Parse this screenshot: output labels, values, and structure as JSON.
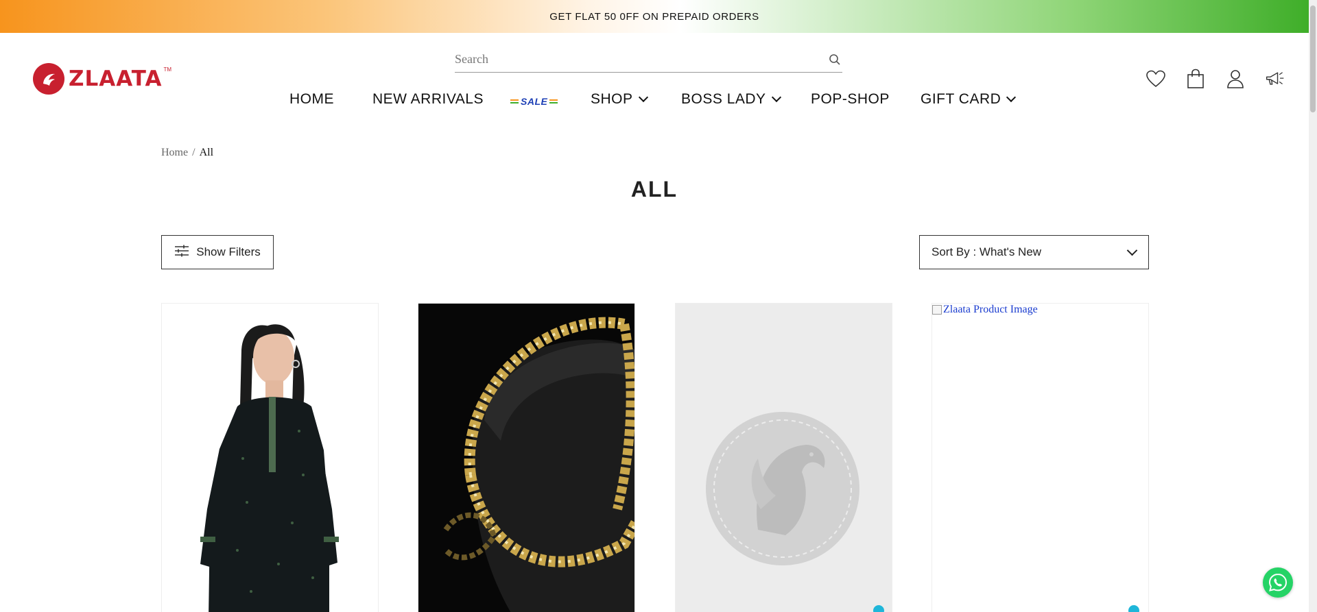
{
  "promo": {
    "text": "GET FLAT 50 0FF ON PREPAID ORDERS"
  },
  "brand": {
    "name": "ZLAATA",
    "tm": "TM",
    "color": "#c8202f"
  },
  "search": {
    "placeholder": "Search"
  },
  "nav": {
    "items": [
      {
        "label": "HOME"
      },
      {
        "label": "NEW ARRIVALS"
      },
      {
        "label": "SALE"
      },
      {
        "label": "SHOP"
      },
      {
        "label": "BOSS LADY"
      },
      {
        "label": "POP-SHOP"
      },
      {
        "label": "GIFT CARD"
      }
    ]
  },
  "header_icons": [
    "heart-icon",
    "bag-icon",
    "user-icon",
    "megaphone-icon"
  ],
  "breadcrumb": {
    "home": "Home",
    "separator": "/",
    "current": "All"
  },
  "page": {
    "title": "ALL"
  },
  "filters": {
    "label": "Show Filters"
  },
  "sort": {
    "label": "Sort By : What's New"
  },
  "products": [
    {
      "image": "black-kurta-model"
    },
    {
      "image": "gold-chain-bracelet"
    },
    {
      "image": "zlaata-placeholder"
    },
    {
      "image_alt": "Zlaata Product Image"
    }
  ],
  "colors": {
    "accent": "#c8202f",
    "dot": "#1fb6d9",
    "whatsapp": "#25d366"
  }
}
